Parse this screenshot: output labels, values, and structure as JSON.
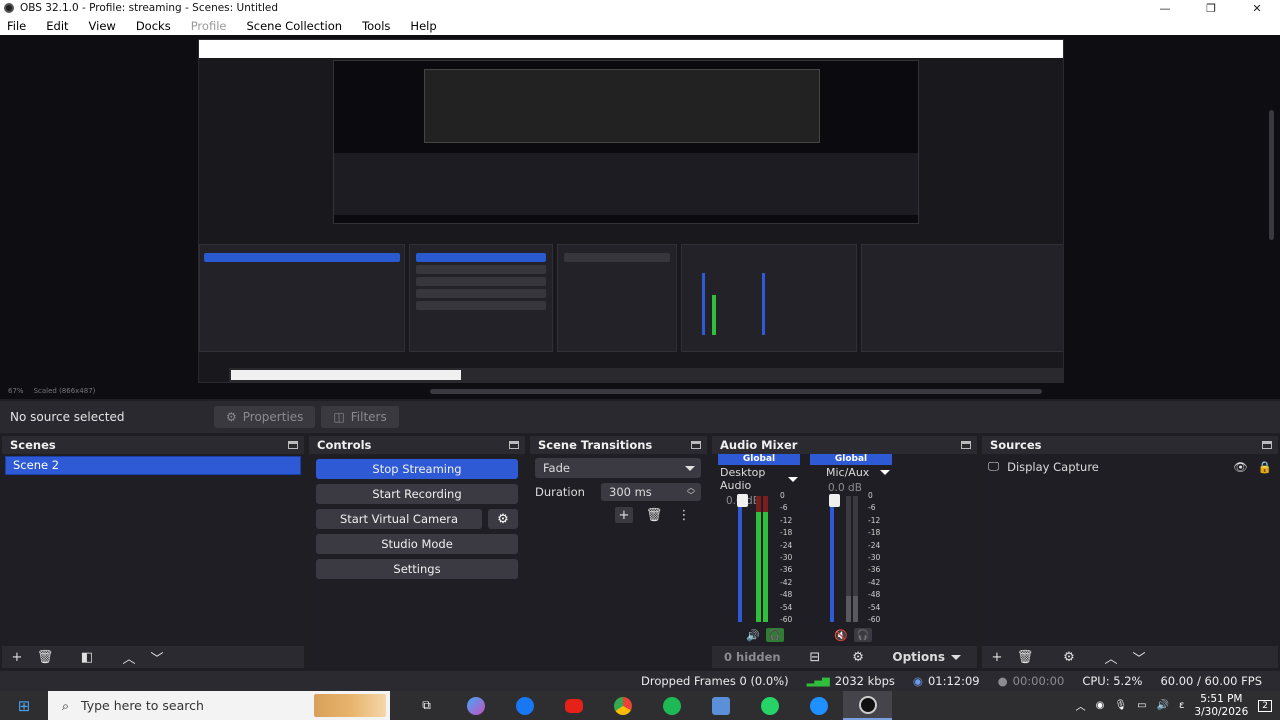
{
  "window": {
    "title": "OBS 32.1.0 - Profile: streaming - Scenes: Untitled",
    "controls": {
      "minimize": "—",
      "maximize": "❐",
      "close": "✕"
    }
  },
  "menu": {
    "file": "File",
    "edit": "Edit",
    "view": "View",
    "docks": "Docks",
    "profile": "Profile",
    "scene_collection": "Scene Collection",
    "tools": "Tools",
    "help": "Help"
  },
  "preview": {
    "zoom": "67%",
    "scaled": "Scaled (866x487)"
  },
  "context": {
    "no_source": "No source selected",
    "properties": "Properties",
    "filters": "Filters"
  },
  "scenes": {
    "title": "Scenes",
    "items": [
      "Scene 2"
    ]
  },
  "controls_dock": {
    "title": "Controls",
    "stop_streaming": "Stop Streaming",
    "start_recording": "Start Recording",
    "start_virtual_camera": "Start Virtual Camera",
    "studio_mode": "Studio Mode",
    "settings": "Settings"
  },
  "transitions": {
    "title": "Scene Transitions",
    "selected": "Fade",
    "duration_label": "Duration",
    "duration_value": "300 ms"
  },
  "mixer": {
    "title": "Audio Mixer",
    "channels": [
      {
        "badge": "Global",
        "name": "Desktop Audio",
        "db": "0.0 dB",
        "volume": 1.0,
        "level": 0.8
      },
      {
        "badge": "Global",
        "name": "Mic/Aux",
        "db": "0.0 dB",
        "volume": 1.0,
        "level": 0.15,
        "muted": true
      }
    ],
    "scale": [
      "0",
      "-6",
      "-12",
      "-18",
      "-24",
      "-30",
      "-36",
      "-42",
      "-48",
      "-54",
      "-60"
    ],
    "hidden": "0 hidden",
    "options": "Options"
  },
  "sources": {
    "title": "Sources",
    "items": [
      "Display Capture"
    ]
  },
  "status": {
    "dropped_frames": "Dropped Frames 0 (0.0%)",
    "bitrate": "2032 kbps",
    "stream_time": "01:12:09",
    "record_time": "00:00:00",
    "cpu": "CPU: 5.2%",
    "fps": "60.00 / 60.00 FPS"
  },
  "taskbar": {
    "search_placeholder": "Type here to search",
    "time": "5:51 PM",
    "date": "3/30/2026",
    "notifications": "2",
    "language": "ε"
  },
  "colors": {
    "accent": "#2f5ad6",
    "panel": "#2b2a31",
    "dock_body": "#1f1e24",
    "meter_green": "#2fbf3a",
    "meter_red": "#7a1e1e"
  }
}
